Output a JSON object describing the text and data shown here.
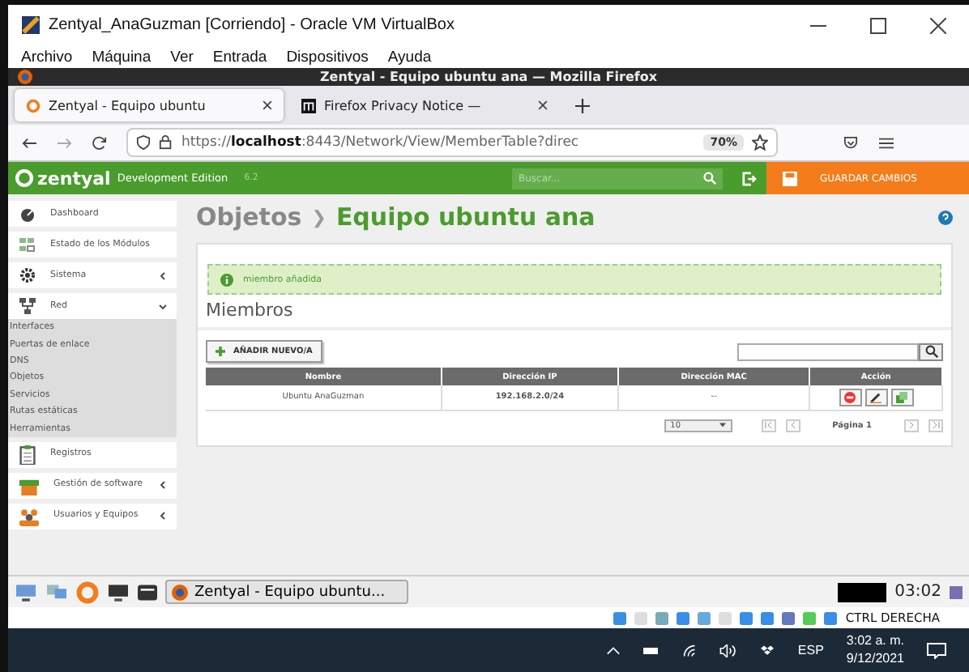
{
  "vbox": {
    "title": "Zentyal_AnaGuzman [Corriendo] - Oracle VM VirtualBox",
    "menu": [
      "Archivo",
      "Máquina",
      "Ver",
      "Entrada",
      "Dispositivos",
      "Ayuda"
    ]
  },
  "firefox": {
    "title": "Zentyal - Equipo ubuntu ana — Mozilla Firefox",
    "tabs": [
      {
        "label": "Zentyal - Equipo ubuntu",
        "selected": true
      },
      {
        "label": "Firefox Privacy Notice —",
        "selected": false
      }
    ],
    "url_prefix": "https://",
    "url_host": "localhost",
    "url_rest": ":8443/Network/View/MemberTable?direc",
    "zoom": "70%"
  },
  "header": {
    "brand": "zentyal",
    "edition": "Development Edition",
    "version": "6.2",
    "search_placeholder": "Buscar...",
    "save": "GUARDAR CAMBIOS"
  },
  "sidebar": [
    {
      "label": "Dashboard"
    },
    {
      "label": "Estado de los Módulos"
    },
    {
      "label": "Sistema",
      "expanded": false
    },
    {
      "label": "Red",
      "expanded": true,
      "children": [
        "Interfaces",
        "Puertas de enlace",
        "DNS",
        "Objetos",
        "Servicios",
        "Rutas estáticas",
        "Herramientas"
      ]
    },
    {
      "label": "Registros"
    },
    {
      "label": "Gestión de software",
      "expanded": false
    },
    {
      "label": "Usuarios y Equipos",
      "expanded": false
    }
  ],
  "breadcrumb": {
    "parent": "Objetos",
    "separator": "❯",
    "current": "Equipo ubuntu ana"
  },
  "notice": "miembro añadida",
  "section_title": "Miembros",
  "add_button": "AÑADIR NUEVO/A",
  "table": {
    "columns": [
      "Nombre",
      "Dirección IP",
      "Dirección MAC",
      "Acción"
    ],
    "rows": [
      {
        "name": "Ubuntu AnaGuzman",
        "ip": "192.168.2.0/24",
        "mac": "--"
      }
    ]
  },
  "pagination": {
    "page_size": "10",
    "page": "Página 1"
  },
  "guest_taskbar": {
    "window": "Zentyal - Equipo ubuntu...",
    "clock": "03:02"
  },
  "vbox_status": {
    "host_key": "CTRL DERECHA"
  },
  "windows_taskbar": {
    "language": "ESP",
    "time": "3:02 a. m.",
    "date": "9/12/2021"
  }
}
